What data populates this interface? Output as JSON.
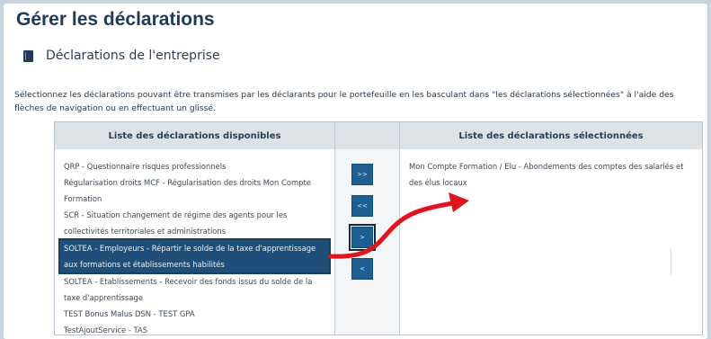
{
  "page_title": "Gérer les déclarations",
  "section": {
    "title": "Déclarations de l'entreprise",
    "icon": "book-icon"
  },
  "instructions": "Sélectionnez les déclarations pouvant être transmises par les déclarants pour le portefeuille en les basculant dans \"les déclarations sélectionnées\" à l'aide des flèches de navigation ou en effectuant un glissé.",
  "available": {
    "header": "Liste des déclarations disponibles",
    "items": [
      "QRP - Questionnaire risques professionnels",
      "Régularisation droits MCF - Régularisation des droits Mon Compte Formation",
      "SCR - Situation changement de régime des agents pour les collectivités territoriales et administrations",
      "SOLTEA - Employeurs - Répartir le solde de la taxe d'apprentissage aux formations et établissements habilités",
      "SOLTEA - Etablissements - Recevoir des fonds issus du solde de la taxe d'apprentissage",
      "TEST Bonus Malus DSN - TEST GPA",
      "TestAjoutService - TAS"
    ],
    "selected_index": 3
  },
  "selected": {
    "header": "Liste des déclarations sélectionnées",
    "items": [
      "Mon Compte Formation / Elu - Abondements des comptes des salariés et des élus locaux"
    ]
  },
  "buttons": {
    "move_all_right": ">>",
    "move_all_left": "<<",
    "move_right": ">",
    "move_left": "<"
  },
  "colors": {
    "accent": "#1e5f93",
    "title": "#1f3a5a",
    "selection": "#1f4f78",
    "annotation_arrow": "#e0141e"
  }
}
